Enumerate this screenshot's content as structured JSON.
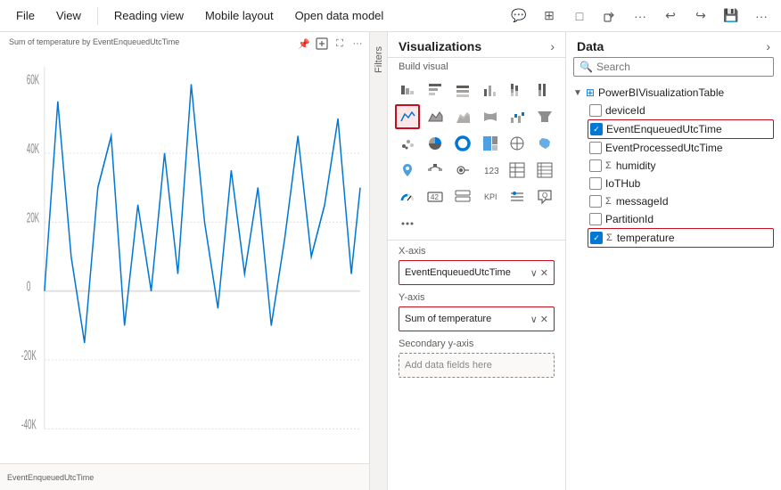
{
  "menubar": {
    "items": [
      "File",
      "View",
      "Reading view",
      "Mobile layout",
      "Open data model"
    ],
    "icons": [
      "💬",
      "⊞",
      "□",
      "⟳",
      "↗",
      "⬚",
      "↩",
      "↪",
      "💾",
      "···"
    ]
  },
  "chart": {
    "title": "Sum of temperature by EventEnqueuedUtcTime",
    "toolbar": [
      "📌",
      "≡",
      "⛶",
      "···"
    ]
  },
  "filters": {
    "label": "Filters"
  },
  "visualizations": {
    "title": "Visualizations",
    "build_label": "Build visual",
    "expand_icon": "›",
    "icons": [
      {
        "name": "stacked-bar",
        "selected": false,
        "symbol": "▦"
      },
      {
        "name": "clustered-bar",
        "selected": false,
        "symbol": "▤"
      },
      {
        "name": "stacked-bar-100",
        "selected": false,
        "symbol": "▥"
      },
      {
        "name": "clustered-column",
        "selected": false,
        "symbol": "▩"
      },
      {
        "name": "stacked-column",
        "selected": false,
        "symbol": "▨"
      },
      {
        "name": "stacked-column-100",
        "selected": false,
        "symbol": "▧"
      },
      {
        "name": "line-chart",
        "selected": true,
        "symbol": "📈"
      },
      {
        "name": "area-chart",
        "selected": false,
        "symbol": "⛰"
      },
      {
        "name": "stacked-area",
        "selected": false,
        "symbol": "〰"
      },
      {
        "name": "ribbon-chart",
        "selected": false,
        "symbol": "🎀"
      },
      {
        "name": "waterfall",
        "selected": false,
        "symbol": "↕"
      },
      {
        "name": "funnel",
        "selected": false,
        "symbol": "⊿"
      },
      {
        "name": "scatter",
        "selected": false,
        "symbol": "⁖"
      },
      {
        "name": "pie",
        "selected": false,
        "symbol": "◔"
      },
      {
        "name": "donut",
        "selected": false,
        "symbol": "◎"
      },
      {
        "name": "treemap",
        "selected": false,
        "symbol": "▦"
      },
      {
        "name": "map",
        "selected": false,
        "symbol": "🗺"
      },
      {
        "name": "filled-map",
        "selected": false,
        "symbol": "🌍"
      },
      {
        "name": "azure-map",
        "selected": false,
        "symbol": "📍"
      },
      {
        "name": "decomp-tree",
        "selected": false,
        "symbol": "🌲"
      },
      {
        "name": "key-influencers",
        "selected": false,
        "symbol": "🔑"
      },
      {
        "name": "smart-narrative",
        "selected": false,
        "symbol": "123"
      },
      {
        "name": "table",
        "selected": false,
        "symbol": "⊞"
      },
      {
        "name": "matrix",
        "selected": false,
        "symbol": "⊟"
      },
      {
        "name": "gauge",
        "selected": false,
        "symbol": "◑"
      },
      {
        "name": "card",
        "selected": false,
        "symbol": "▭"
      },
      {
        "name": "multi-row-card",
        "selected": false,
        "symbol": "▬"
      },
      {
        "name": "kpi",
        "selected": false,
        "symbol": "↗"
      },
      {
        "name": "slicer",
        "selected": false,
        "symbol": "≡"
      },
      {
        "name": "qna",
        "selected": false,
        "symbol": "❓"
      },
      {
        "name": "more",
        "selected": false,
        "symbol": "···"
      }
    ],
    "fields": {
      "x_axis": {
        "label": "X-axis",
        "value": "EventEnqueuedUtcTime",
        "active": true
      },
      "y_axis": {
        "label": "Y-axis",
        "value": "Sum of temperature",
        "active": true
      },
      "secondary_y": {
        "label": "Secondary y-axis",
        "placeholder": "Add data fields here"
      }
    }
  },
  "data": {
    "title": "Data",
    "expand_icon": "›",
    "search": {
      "placeholder": "Search",
      "value": ""
    },
    "table": {
      "name": "PowerBIVisualizationTable",
      "fields": [
        {
          "name": "deviceId",
          "checked": false,
          "sigma": false,
          "highlighted": false
        },
        {
          "name": "EventEnqueuedUtcTime",
          "checked": true,
          "sigma": false,
          "highlighted": true
        },
        {
          "name": "EventProcessedUtcTime",
          "checked": false,
          "sigma": false,
          "highlighted": false
        },
        {
          "name": "humidity",
          "checked": false,
          "sigma": true,
          "highlighted": false
        },
        {
          "name": "IoTHub",
          "checked": false,
          "sigma": false,
          "highlighted": false
        },
        {
          "name": "messageId",
          "checked": false,
          "sigma": true,
          "highlighted": false
        },
        {
          "name": "PartitionId",
          "checked": false,
          "sigma": false,
          "highlighted": false
        },
        {
          "name": "temperature",
          "checked": true,
          "sigma": true,
          "highlighted": true
        }
      ]
    }
  }
}
